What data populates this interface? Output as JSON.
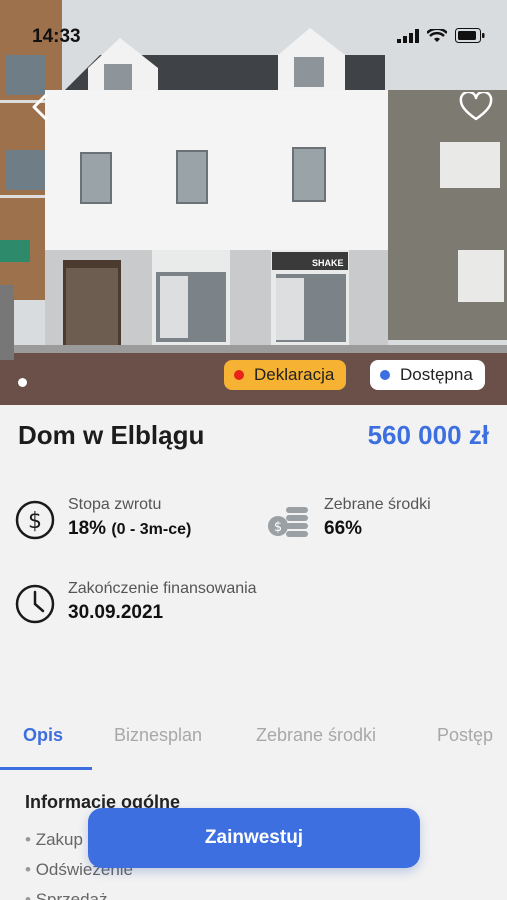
{
  "status_bar": {
    "time": "14:33"
  },
  "hero": {
    "badges": [
      {
        "label": "Deklaracja",
        "dot_color": "#e8241a",
        "bg": "#f6b233"
      },
      {
        "label": "Dostępna",
        "dot_color": "#3d6fe0",
        "bg": "#ffffff"
      }
    ],
    "shop_sign": "SHAKE"
  },
  "listing": {
    "title": "Dom w Elblągu",
    "price": "560 000 zł"
  },
  "stats": {
    "return_rate": {
      "label": "Stopa zwrotu",
      "value": "18%",
      "detail": "(0 - 3m-ce)",
      "icon": "dollar-circle-icon"
    },
    "collected": {
      "label": "Zebrane środki",
      "value": "66%",
      "icon": "coins-stack-icon"
    },
    "funding_end": {
      "label": "Zakończenie finansowania",
      "value": "30.09.2021",
      "icon": "clock-icon"
    }
  },
  "tabs": [
    {
      "label": "Opis",
      "active": true
    },
    {
      "label": "Biznesplan",
      "active": false
    },
    {
      "label": "Zebrane środki",
      "active": false
    },
    {
      "label": "Postęp",
      "active": false
    }
  ],
  "description": {
    "section_title": "Informacje ogólne",
    "items": [
      "Zakup",
      "Odświeżenie",
      "Sprzedaż"
    ]
  },
  "cta": {
    "label": "Zainwestuj"
  },
  "colors": {
    "accent": "#3d6fe0",
    "badge_yellow": "#f6b233"
  }
}
